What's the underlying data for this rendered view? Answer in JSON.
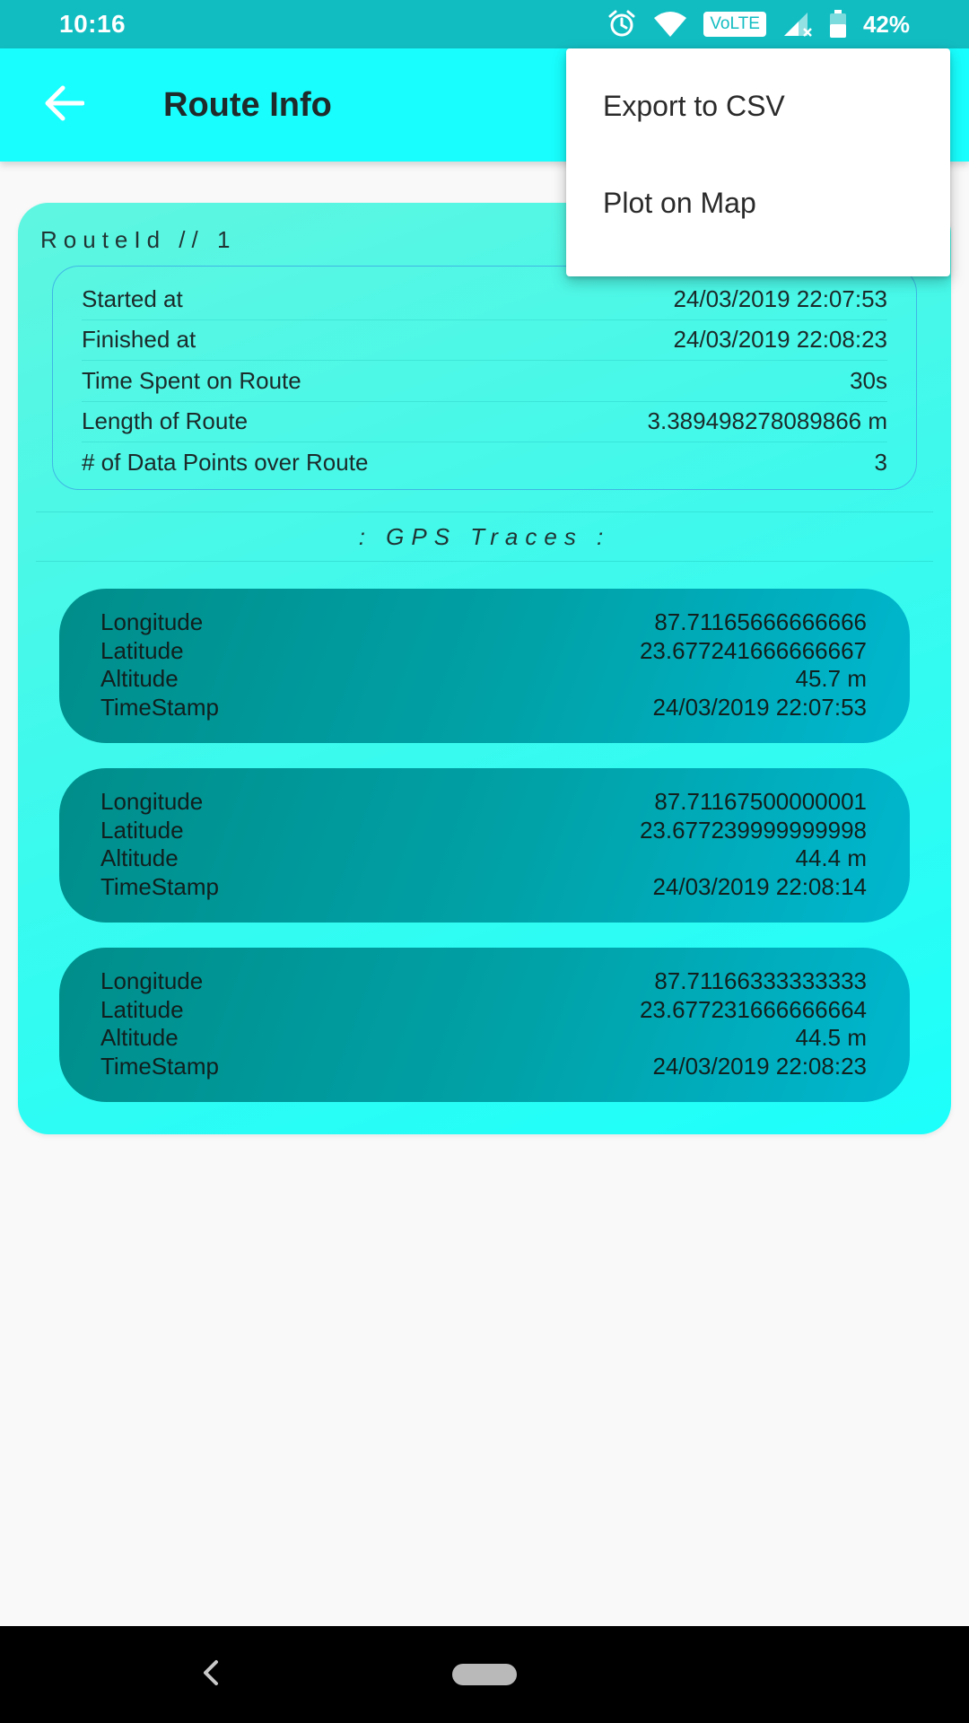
{
  "status_bar": {
    "time": "10:16",
    "volte": "VoLTE",
    "battery": "42%"
  },
  "app_bar": {
    "title": "Route Info",
    "back_icon": "arrow-left-icon"
  },
  "route": {
    "id_label": "RouteId // 1",
    "summary": [
      {
        "label": "Started at",
        "value": "24/03/2019 22:07:53"
      },
      {
        "label": "Finished at",
        "value": "24/03/2019 22:08:23"
      },
      {
        "label": "Time Spent on Route",
        "value": "30s"
      },
      {
        "label": "Length of Route",
        "value": "3.389498278089866 m"
      },
      {
        "label": "# of Data Points over Route",
        "value": "3"
      }
    ],
    "traces_heading": ": GPS Traces :",
    "traces": [
      {
        "longitude_label": "Longitude",
        "longitude": "87.71165666666666",
        "latitude_label": "Latitude",
        "latitude": "23.677241666666667",
        "altitude_label": "Altitude",
        "altitude": "45.7 m",
        "timestamp_label": "TimeStamp",
        "timestamp": "24/03/2019 22:07:53"
      },
      {
        "longitude_label": "Longitude",
        "longitude": "87.71167500000001",
        "latitude_label": "Latitude",
        "latitude": "23.677239999999998",
        "altitude_label": "Altitude",
        "altitude": "44.4 m",
        "timestamp_label": "TimeStamp",
        "timestamp": "24/03/2019 22:08:14"
      },
      {
        "longitude_label": "Longitude",
        "longitude": "87.71166333333333",
        "latitude_label": "Latitude",
        "latitude": "23.677231666666664",
        "altitude_label": "Altitude",
        "altitude": "44.5 m",
        "timestamp_label": "TimeStamp",
        "timestamp": "24/03/2019 22:08:23"
      }
    ]
  },
  "popup_menu": {
    "items": [
      {
        "label": "Export to CSV"
      },
      {
        "label": "Plot on Map"
      }
    ]
  },
  "colors": {
    "status_bar": "#12bdc2",
    "app_bar": "#18fefe",
    "card_accent": "#3ff9ec",
    "trace_card": "#00a2a8"
  }
}
